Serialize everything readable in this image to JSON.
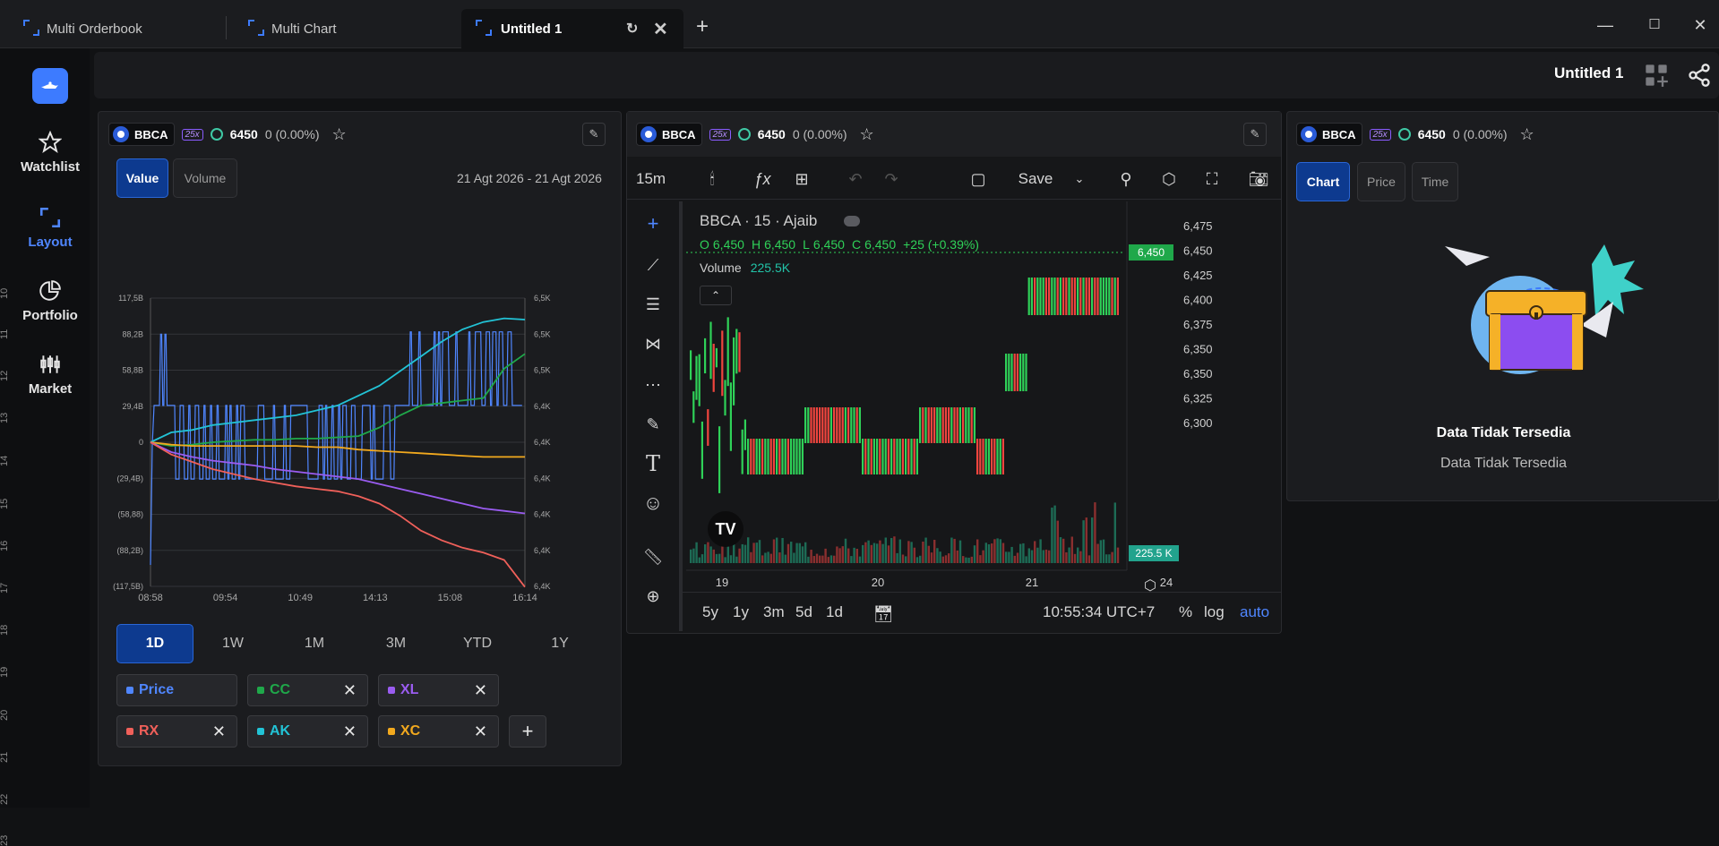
{
  "tabs": [
    {
      "label": "Multi Orderbook"
    },
    {
      "label": "Multi Chart"
    },
    {
      "label": "Untitled 1"
    }
  ],
  "sidebar": {
    "items": [
      {
        "label": "Watchlist"
      },
      {
        "label": "Layout"
      },
      {
        "label": "Portfolio"
      },
      {
        "label": "Market"
      }
    ],
    "row_numbers": [
      "10",
      "11",
      "12",
      "13",
      "14",
      "15",
      "16",
      "17",
      "18",
      "19",
      "20",
      "21",
      "22",
      "23"
    ]
  },
  "topbar": {
    "title": "Untitled 1"
  },
  "symbol": {
    "ticker": "BBCA",
    "leverage": "25x",
    "price": "6450",
    "change": "0 (0.00%)"
  },
  "left_panel": {
    "toggles": [
      {
        "label": "Value"
      },
      {
        "label": "Volume"
      }
    ],
    "date_range": "21 Agt 2026 - 21 Agt 2026",
    "chart_data": {
      "type": "line",
      "x_ticks": [
        "08:58",
        "09:54",
        "10:49",
        "14:13",
        "15:08",
        "16:14"
      ],
      "y_left_ticks": [
        "117,5B",
        "88,2B",
        "58,8B",
        "29,4B",
        "0",
        "(29,4B)",
        "(58,88)",
        "(88,2B)",
        "(117,5B)"
      ],
      "y_right_ticks": [
        "6,5K",
        "6,5K",
        "6,5K",
        "6,4K",
        "6,4K",
        "6,4K",
        "6,4K",
        "6,4K",
        "6,4K"
      ],
      "series": [
        {
          "name": "AK",
          "color": "#22c3d6",
          "values": [
            0,
            8,
            10,
            14,
            16,
            18,
            20,
            22,
            26,
            30,
            38,
            46,
            58,
            70,
            82,
            92,
            98,
            101,
            100
          ]
        },
        {
          "name": "CC",
          "color": "#1fa84a",
          "values": [
            0,
            -3,
            -2,
            0,
            1,
            2,
            2,
            3,
            3,
            4,
            5,
            12,
            22,
            30,
            32,
            34,
            36,
            60,
            72
          ]
        },
        {
          "name": "XC",
          "color": "#f2a91e",
          "values": [
            0,
            -2,
            -3,
            -3,
            -3,
            -3,
            -3,
            -3,
            -4,
            -4,
            -6,
            -7,
            -8,
            -9,
            -10,
            -11,
            -12,
            -12,
            -12
          ]
        },
        {
          "name": "XL",
          "color": "#9a5cf0",
          "values": [
            0,
            -8,
            -12,
            -15,
            -17,
            -19,
            -22,
            -24,
            -26,
            -28,
            -30,
            -34,
            -38,
            -42,
            -46,
            -50,
            -54,
            -56,
            -58
          ]
        },
        {
          "name": "RX",
          "color": "#f0605a",
          "values": [
            0,
            -10,
            -16,
            -22,
            -26,
            -30,
            -33,
            -36,
            -38,
            -40,
            -44,
            -50,
            -60,
            -72,
            -80,
            -86,
            -90,
            -96,
            -118
          ]
        }
      ]
    },
    "ranges": [
      {
        "label": "1D"
      },
      {
        "label": "1W"
      },
      {
        "label": "1M"
      },
      {
        "label": "3M"
      },
      {
        "label": "YTD"
      },
      {
        "label": "1Y"
      }
    ],
    "chips": [
      {
        "label": "Price",
        "color": "#4f86ff"
      },
      {
        "label": "CC",
        "color": "#1fa84a"
      },
      {
        "label": "XL",
        "color": "#9a5cf0"
      },
      {
        "label": "RX",
        "color": "#f0605a"
      },
      {
        "label": "AK",
        "color": "#22c3d6"
      },
      {
        "label": "XC",
        "color": "#f2a91e"
      }
    ]
  },
  "center_panel": {
    "interval": "15m",
    "save_label": "Save",
    "legend": {
      "title": "BBCA · 15 · Ajaib",
      "o": "6,450",
      "h": "6,450",
      "l": "6,450",
      "c": "6,450",
      "chg": "+25 (+0.39%)",
      "volume_label": "Volume",
      "volume": "225.5K"
    },
    "chart_data": {
      "type": "candlestick",
      "y_ticks": [
        "6,475",
        "6,450",
        "6,425",
        "6,400",
        "6,375",
        "6,350",
        "6,350",
        "6,325",
        "6,300"
      ],
      "x_ticks": [
        "19",
        "20",
        "21",
        "24"
      ],
      "last_price": "6,450",
      "last_volume": "225.5 K"
    },
    "ranges": [
      "5y",
      "1y",
      "3m",
      "5d",
      "1d"
    ],
    "clock": "10:55:34 UTC+7",
    "scale_opts": [
      "%",
      "log",
      "auto"
    ]
  },
  "right_panel": {
    "tabs": [
      {
        "label": "Chart"
      },
      {
        "label": "Price"
      },
      {
        "label": "Time"
      }
    ],
    "empty_title": "Data Tidak Tersedia",
    "empty_sub": "Data Tidak Tersedia"
  }
}
